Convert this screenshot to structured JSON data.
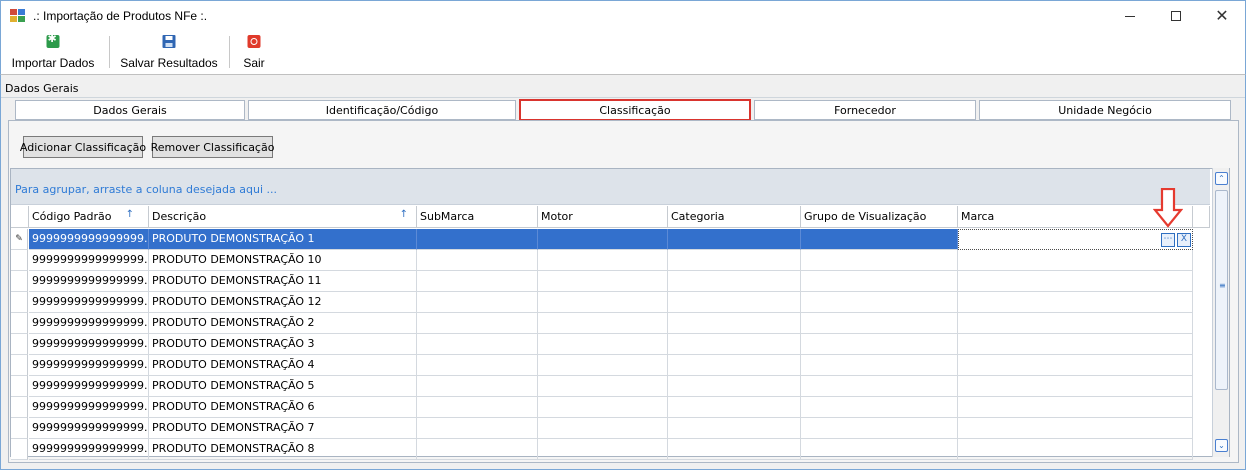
{
  "window": {
    "title": ".: Importação de Produtos NFe :.",
    "controls": {
      "minimize": "minimize-icon",
      "maximize": "maximize-icon",
      "close": "close-icon"
    }
  },
  "toolbar": {
    "import_label": "Importar Dados",
    "save_label": "Salvar Resultados",
    "exit_label": "Sair"
  },
  "group": {
    "caption": "Dados Gerais"
  },
  "tabs": [
    {
      "label": "Dados Gerais",
      "active": false
    },
    {
      "label": "Identificação/Código",
      "active": false
    },
    {
      "label": "Classificação",
      "active": true
    },
    {
      "label": "Fornecedor",
      "active": false
    },
    {
      "label": "Unidade Negócio",
      "active": false
    }
  ],
  "actions": {
    "add_label": "Adicionar Classificação",
    "remove_label": "Remover Classificação"
  },
  "grid": {
    "group_hint": "Para agrupar, arraste a coluna desejada aqui ...",
    "columns": [
      "Código Padrão",
      "Descrição",
      "SubMarca",
      "Motor",
      "Categoria",
      "Grupo de Visualização",
      "Marca"
    ],
    "sort_icon": "sort-ascending-icon",
    "rows": [
      {
        "code": "9999999999999999...",
        "desc": "PRODUTO DEMONSTRAÇÃO 1",
        "selected": true
      },
      {
        "code": "9999999999999999...",
        "desc": "PRODUTO DEMONSTRAÇÃO 10"
      },
      {
        "code": "9999999999999999...",
        "desc": "PRODUTO DEMONSTRAÇÃO 11"
      },
      {
        "code": "9999999999999999...",
        "desc": "PRODUTO DEMONSTRAÇÃO 12"
      },
      {
        "code": "9999999999999999...",
        "desc": "PRODUTO DEMONSTRAÇÃO 2"
      },
      {
        "code": "9999999999999999...",
        "desc": "PRODUTO DEMONSTRAÇÃO 3"
      },
      {
        "code": "9999999999999999...",
        "desc": "PRODUTO DEMONSTRAÇÃO 4"
      },
      {
        "code": "9999999999999999...",
        "desc": "PRODUTO DEMONSTRAÇÃO 5"
      },
      {
        "code": "9999999999999999...",
        "desc": "PRODUTO DEMONSTRAÇÃO 6"
      },
      {
        "code": "9999999999999999...",
        "desc": "PRODUTO DEMONSTRAÇÃO 7"
      },
      {
        "code": "9999999999999999...",
        "desc": "PRODUTO DEMONSTRAÇÃO 8"
      }
    ],
    "marca_editor": {
      "ellipsis_icon": "ellipsis-icon",
      "clear_icon": "clear-icon"
    }
  },
  "colors": {
    "selection": "#3370cc",
    "active_tab_border": "#d9342e",
    "hint_text": "#2f7bd6",
    "annotation_arrow": "#e53a2f"
  }
}
